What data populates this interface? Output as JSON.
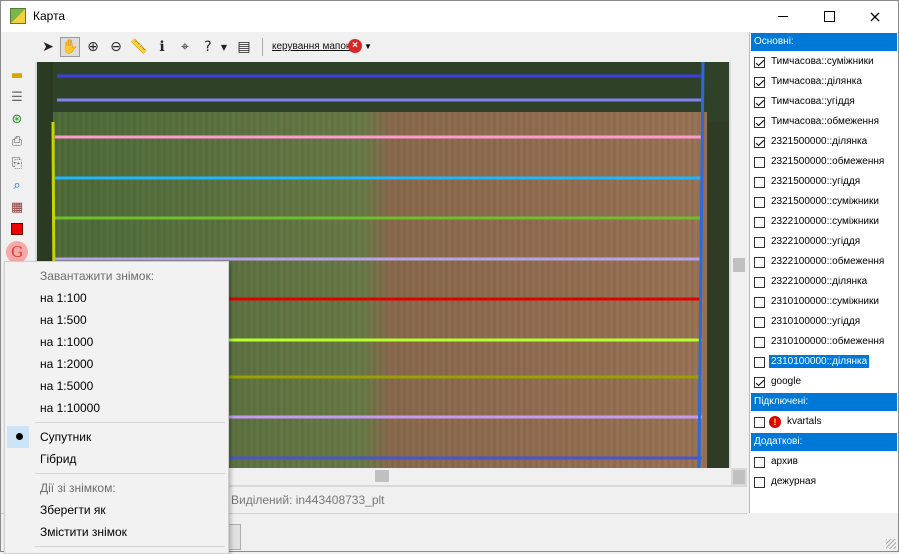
{
  "window": {
    "title": "Карта",
    "controls": {
      "minimize": "minimize",
      "maximize": "maximize",
      "close": "×"
    }
  },
  "toolbar": {
    "tools": [
      "select-arrow-icon",
      "pan-hand-icon",
      "zoom-in-icon",
      "zoom-out-icon",
      "ruler-icon",
      "info-icon",
      "measure-icon",
      "help-query-icon",
      "dropdown-caret-icon",
      "layer-panel-icon"
    ],
    "map_control_label": "керування мапою"
  },
  "left_tools": [
    "folder-icon",
    "layers-list-icon",
    "globe-icon",
    "print-icon",
    "print-preview-icon",
    "zoom-search-icon",
    "mosaic-icon",
    "red-square-icon",
    "google-icon"
  ],
  "left_google_letter": "G",
  "status": {
    "selected": "Виділений: in443408733_plt"
  },
  "layers": {
    "groups": [
      {
        "title": "Основні:",
        "items": [
          {
            "label": "Тимчасова::суміжники",
            "checked": true
          },
          {
            "label": "Тимчасова::ділянка",
            "checked": true
          },
          {
            "label": "Тимчасова::угіддя",
            "checked": true
          },
          {
            "label": "Тимчасова::обмеження",
            "checked": true
          },
          {
            "label": "2321500000::ділянка",
            "checked": true
          },
          {
            "label": "2321500000::обмеження",
            "checked": false
          },
          {
            "label": "2321500000::угіддя",
            "checked": false
          },
          {
            "label": "2321500000::суміжники",
            "checked": false
          },
          {
            "label": "2322100000::суміжники",
            "checked": false
          },
          {
            "label": "2322100000::угіддя",
            "checked": false
          },
          {
            "label": "2322100000::обмеження",
            "checked": false
          },
          {
            "label": "2322100000::ділянка",
            "checked": false
          },
          {
            "label": "2310100000::суміжники",
            "checked": false
          },
          {
            "label": "2310100000::угіддя",
            "checked": false
          },
          {
            "label": "2310100000::обмеження",
            "checked": false
          },
          {
            "label": "2310100000::ділянка",
            "checked": false,
            "highlighted": true
          },
          {
            "label": "google",
            "checked": true
          }
        ]
      },
      {
        "title": "Підключені:",
        "items": [
          {
            "label": "kvartals",
            "checked": false,
            "warn": "!"
          }
        ]
      },
      {
        "title": "Додаткові:",
        "items": [
          {
            "label": "архив",
            "checked": false
          },
          {
            "label": "дежурная",
            "checked": false
          }
        ]
      }
    ]
  },
  "context_menu": {
    "load_header": "Завантажити знімок:",
    "scales": [
      "на 1:100",
      "на 1:500",
      "на 1:1000",
      "на 1:2000",
      "на 1:5000",
      "на 1:10000"
    ],
    "satellite": "Супутник",
    "hybrid": "Гібрид",
    "actions_header": "Дії зі знімком:",
    "save_as": "Зберегти як",
    "move": "Змістити знімок",
    "selected_mode": "Супутник"
  },
  "map": {
    "boundary_colors": [
      "#3a3fe0",
      "#7f84ef",
      "#ff9ad1",
      "#1fb6ff",
      "#6fbf2a",
      "#b9a3e8",
      "#e00000",
      "#b6ff2a",
      "#9aa000",
      "#c59af0",
      "#4a56c8"
    ],
    "field_rows_fraction": [
      0.02,
      0.08,
      0.17,
      0.27,
      0.37,
      0.47,
      0.57,
      0.67,
      0.76,
      0.86,
      0.96
    ]
  }
}
